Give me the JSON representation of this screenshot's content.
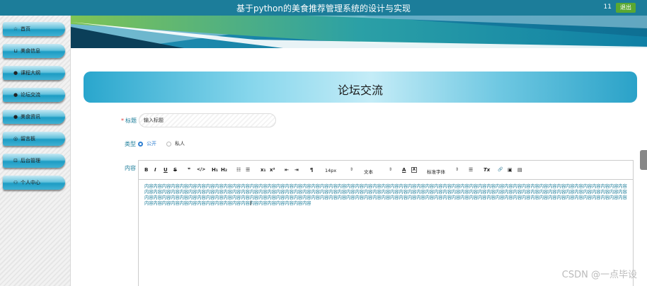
{
  "app": {
    "title": "基于python的美食推荐管理系统的设计与实现",
    "user": "11",
    "logout_label": "退出"
  },
  "sidebar": {
    "items": [
      {
        "label": "首页",
        "icon": "star-icon",
        "glyph": "☆"
      },
      {
        "label": "美食信息",
        "icon": "bag-icon",
        "glyph": "⊔"
      },
      {
        "label": "课程大纲",
        "icon": "info-icon",
        "glyph": "●"
      },
      {
        "label": "论坛交流",
        "icon": "info-icon",
        "glyph": "●"
      },
      {
        "label": "美食资讯",
        "icon": "info-icon",
        "glyph": "●"
      },
      {
        "label": "留言板",
        "icon": "settings-icon",
        "glyph": "◎"
      },
      {
        "label": "后台管理",
        "icon": "lock-icon",
        "glyph": "⊡"
      },
      {
        "label": "个人中心",
        "icon": "user-icon",
        "glyph": "⚇"
      }
    ]
  },
  "page": {
    "header": "论坛交流"
  },
  "form": {
    "title_label": "标题",
    "title_placeholder": "输入标题",
    "type_label": "类型",
    "type_options": [
      "公开",
      "私人"
    ],
    "type_selected": "公开",
    "content_label": "内容",
    "content_text": "内容内容内容内容内容内容内容内容内容内容内容内容内容内容内容内容内容内容内容内容内容内容内容内容内容内容内容内容内容内容内容内容内容内容内容内容内容内容内容内容内容内容内容内容内容内容内容内容内容内容内容内容内容内容内容内容内容内容内容内容内容内容内容内容内容内容内容内容内容内容内容内容内容内容内容内容内容内容内容内容内容内容内容内容内容内容内容内容内容内容内容内容内容内容内容内容内容内容内容内容内容内容内容内容内容内容内容内容内容内容内容内容内容内容内容内容内容内容内容内容内容内容内容内容内容内容内容内容内容内容内容内容内容内容内容内容内容内容内容内容内容内容内容内容内容内容内容内容内容内容内容内容内容内容内容内容内容内容内容内容内容内容内容内容内容内容内容内容内容内容内容内容内容内容内容内容内容内容内容内容内容内容内容内容"
  },
  "toolbar": {
    "bold": "B",
    "italic": "I",
    "underline": "U",
    "strike": "S",
    "quote": "❞",
    "code": "</>",
    "h1": "H₁",
    "h2": "H₂",
    "ol": "☷",
    "ul": "☰",
    "sub": "x₁",
    "sup": "x²",
    "outdent": "⇤",
    "indent": "⇥",
    "direction": "¶",
    "font_size": "14px",
    "text_type": "文本",
    "font_color": "A",
    "bg_color": "A",
    "font_family": "标准字体",
    "align": "☰",
    "clear_format": "Tx",
    "link": "🔗",
    "image": "▣",
    "video": "▤"
  },
  "watermark": "CSDN @一点毕设",
  "colors": {
    "topbar": "#1c7d9a",
    "accent": "#1c7d9a",
    "logout": "#5aa832"
  }
}
